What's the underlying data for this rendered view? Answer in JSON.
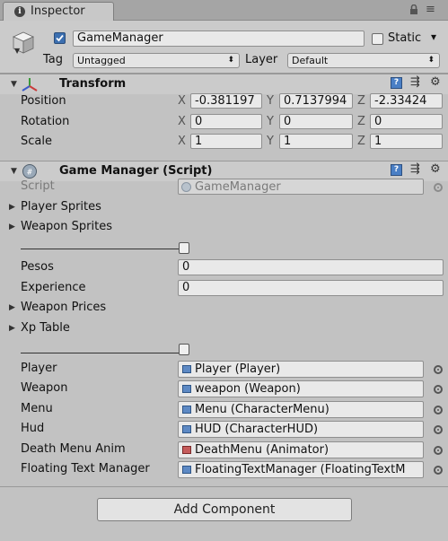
{
  "tab": {
    "title": "Inspector"
  },
  "header": {
    "object_name": "GameManager",
    "active_checked": true,
    "static_label": "Static",
    "static_arrow": "▾",
    "tag_label": "Tag",
    "tag_value": "Untagged",
    "layer_label": "Layer",
    "layer_value": "Default"
  },
  "transform": {
    "title": "Transform",
    "rows": [
      {
        "label": "Position",
        "x": "-0.381197",
        "y": "0.7137994",
        "z": "-2.33424"
      },
      {
        "label": "Rotation",
        "x": "0",
        "y": "0",
        "z": "0"
      },
      {
        "label": "Scale",
        "x": "1",
        "y": "1",
        "z": "1"
      }
    ],
    "axis": {
      "x": "X",
      "y": "Y",
      "z": "Z"
    }
  },
  "script_component": {
    "title": "Game Manager (Script)",
    "script_label": "Script",
    "script_value": "GameManager",
    "player_sprites": "Player Sprites",
    "weapon_sprites": "Weapon Sprites",
    "pesos_label": "Pesos",
    "pesos_value": "0",
    "experience_label": "Experience",
    "experience_value": "0",
    "weapon_prices": "Weapon Prices",
    "xp_table": "Xp Table",
    "refs": [
      {
        "label": "Player",
        "value": "Player (Player)",
        "icon": "script-icon"
      },
      {
        "label": "Weapon",
        "value": "weapon (Weapon)",
        "icon": "script-icon"
      },
      {
        "label": "Menu",
        "value": "Menu (CharacterMenu)",
        "icon": "script-icon"
      },
      {
        "label": "Hud",
        "value": "HUD (CharacterHUD)",
        "icon": "script-icon"
      },
      {
        "label": "Death Menu Anim",
        "value": "DeathMenu (Animator)",
        "icon": "animator-icon"
      },
      {
        "label": "Floating Text Manager",
        "value": "FloatingTextManager (FloatingTextM",
        "icon": "script-icon"
      }
    ]
  },
  "add_component": "Add Component"
}
